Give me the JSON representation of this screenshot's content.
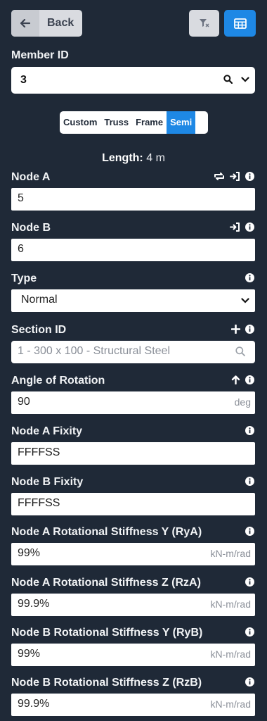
{
  "toolbar": {
    "back_label": "Back"
  },
  "member": {
    "label": "Member ID",
    "value": "3"
  },
  "modes": [
    "Custom",
    "Truss",
    "Frame",
    "Semi"
  ],
  "active_mode": "Semi",
  "length": {
    "label": "Length:",
    "value": "4 m"
  },
  "node_a": {
    "label": "Node A",
    "value": "5"
  },
  "node_b": {
    "label": "Node B",
    "value": "6"
  },
  "type": {
    "label": "Type",
    "value": "Normal"
  },
  "section": {
    "label": "Section ID",
    "placeholder": "1 - 300 x 100 - Structural Steel"
  },
  "rotation": {
    "label": "Angle of Rotation",
    "value": "90",
    "unit": "deg"
  },
  "node_a_fixity": {
    "label": "Node A Fixity",
    "value": "FFFFSS"
  },
  "node_b_fixity": {
    "label": "Node B Fixity",
    "value": "FFFFSS"
  },
  "rya": {
    "label": "Node A Rotational Stiffness Y (RyA)",
    "value": "99%",
    "unit": "kN-m/rad"
  },
  "rza": {
    "label": "Node A Rotational Stiffness Z (RzA)",
    "value": "99.9%",
    "unit": "kN-m/rad"
  },
  "ryb": {
    "label": "Node B Rotational Stiffness Y (RyB)",
    "value": "99%",
    "unit": "kN-m/rad"
  },
  "rzb": {
    "label": "Node B Rotational Stiffness Z (RzB)",
    "value": "99.9%",
    "unit": "kN-m/rad"
  },
  "colors": {
    "background": "#1f2937",
    "accent": "#1e88e5",
    "button_grey": "#d9dbe0"
  }
}
